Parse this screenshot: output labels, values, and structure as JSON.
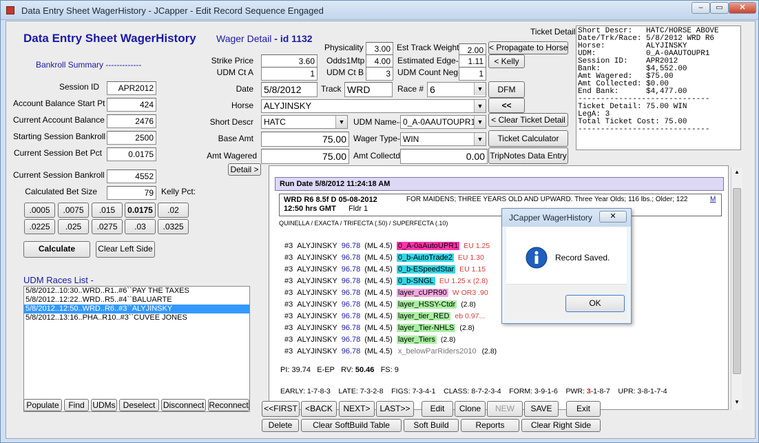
{
  "window": {
    "title": "Data Entry Sheet WagerHistory - JCapper -   Edit Record Sequence Engaged",
    "minimize": "‒",
    "maximize": "▭",
    "close": "✕"
  },
  "left": {
    "heading": "Data Entry Sheet WagerHistory",
    "bankroll_heading": "Bankroll Summary -------------",
    "fields": [
      {
        "label": "Session ID",
        "value": "APR2012"
      },
      {
        "label": "Account Balance Start Pt",
        "value": "424"
      },
      {
        "label": "Current Account Balance",
        "value": "2476"
      },
      {
        "label": "Starting Session Bankroll",
        "value": "2500"
      },
      {
        "label": "Current Session Bet Pct",
        "value": "0.0175"
      },
      {
        "label": "Current Session Bankroll",
        "value": "4552"
      },
      {
        "label": "Calculated Bet Size",
        "value": "79"
      }
    ],
    "kelly_pct_label": "Kelly Pct:",
    "pct_buttons_row1": [
      ".0005",
      ".0075",
      ".015",
      "0.0175",
      ".02"
    ],
    "pct_buttons_row2": [
      ".0225",
      ".025",
      ".0275",
      ".03",
      ".0325"
    ],
    "calculate": "Calculate",
    "clear_left": "Clear Left Side",
    "udm_races_heading": "UDM Races List -",
    "udm_races": [
      "5/8/2012..10:30..WRD..R1..#6``PAY THE TAXES",
      "5/8/2012..12:22..WRD..R5..#4``BALUARTE",
      "5/8/2012..12:50..WRD..R6..#3``ALYJINSKY",
      "5/8/2012..13:16..PHA..R10..#3``CUVEE JONES"
    ],
    "selected_race_index": 2,
    "bottom_buttons": [
      "Populate",
      "Find",
      "UDMs",
      "Deselect",
      "Disconnect",
      "Reconnect"
    ]
  },
  "wager": {
    "heading": "Wager Detail",
    "id": "- id 1132",
    "strike_price_label": "Strike Price",
    "strike_price": "3.60",
    "udm_ct_a_label": "UDM Ct A",
    "udm_ct_a": "1",
    "physicality_label": "Physicality",
    "physicality": "3.00",
    "odds1mtp_label": "Odds1Mtp",
    "odds1mtp": "4.00",
    "udm_ct_b_label": "UDM Ct B",
    "udm_ct_b": "3",
    "est_track_weight_label": "Est Track Weight--",
    "est_track_weight": "2.00",
    "estimated_edge_label": "Estimated Edge---",
    "estimated_edge": "1.11",
    "udm_count_neg_label": "UDM Count Neg---",
    "udm_count_neg": "1",
    "date_label": "Date",
    "date": "5/8/2012",
    "track_label": "Track",
    "track": "WRD",
    "race_label": "Race #",
    "race": "6",
    "horse_label": "Horse",
    "horse": "ALYJINSKY",
    "short_descr_label": "Short Descr",
    "short_descr": "HATC",
    "udm_name_label": "UDM Name--",
    "udm_name": "0_A-0AAUTOUPR1",
    "base_amt_label": "Base Amt",
    "base_amt": "75.00",
    "wager_type_label": "Wager Type-",
    "wager_type": "WIN",
    "amt_wagered_label": "Amt Wagered",
    "amt_wagered": "75.00",
    "amt_collected_label": "Amt Collectd-",
    "amt_collected": "0.00",
    "detail_button": "Detail >"
  },
  "right_buttons": {
    "propagate": "< Propagate to Horse",
    "kelly": "< Kelly",
    "dfm": "DFM",
    "back": "<<",
    "clear_ticket": "< Clear Ticket Detail",
    "ticket_calc": "Ticket Calculator",
    "tripnotes": "TripNotes Data Entry"
  },
  "ticket": {
    "label": "Ticket Detail--",
    "text": "Short Descr:   HATC/HORSE ABOVE\nDate/Trk/Race: 5/8/2012 WRD R6\nHorse:         ALYJINSKY\nUDM:           0_A-0AAUTOUPR1\nSession ID:    APR2012\nBank:          $4,552.00\nAmt Wagered:   $75.00\nAmt Collected: $0.00\nEnd Bank:      $4,477.00\n-----------------------------\nTicket Detail: 75.00 WIN\nLegA: 3\nTotal Ticket Cost: 75.00\n-----------------------------"
  },
  "sheet": {
    "rundate": "Run Date 5/8/2012 11:24:18 AM",
    "race_hdr1": "WRD R6 8.5f D 05-08-2012",
    "race_conditions": "FOR MAIDENS; THREE YEARS OLD AND UPWARD. Three Year Olds; 116 lbs.; Older; 122",
    "race_m": "M",
    "race_hdr2": "12:50  hrs GMT",
    "race_fldr": "Fldr 1",
    "bet_types": "QUINELLA / EXACTA / TRIFECTA (.50) / SUPERFECTA (.10)",
    "rows": [
      {
        "post": "#3",
        "horse": "ALYJINSKY",
        "score": "96.78",
        "ml": "(ML 4.5)",
        "udm": "0_A-0aAutoUPR1",
        "tail": "EU 1.25",
        "tail_color": "#d63a3a",
        "bg": "#ff33aa",
        "fg": "#000000"
      },
      {
        "post": "#3",
        "horse": "ALYJINSKY",
        "score": "96.78",
        "ml": "(ML 4.5)",
        "udm": "0_b-AutoTrade2",
        "tail": "EU 1.30",
        "tail_color": "#d63a3a",
        "bg": "#33d6e6",
        "fg": "#000000"
      },
      {
        "post": "#3",
        "horse": "ALYJINSKY",
        "score": "96.78",
        "ml": "(ML 4.5)",
        "udm": "0_b-ESpeedStar",
        "tail": "EU 1.15",
        "tail_color": "#d63a3a",
        "bg": "#33d6e6",
        "fg": "#000000"
      },
      {
        "post": "#3",
        "horse": "ALYJINSKY",
        "score": "96.78",
        "ml": "(ML 4.5)",
        "udm": "0_b-SNGL",
        "tail": "EU 1.25  x  (2.8)",
        "tail_color": "#d63a3a",
        "bg": "#33d6e6",
        "fg": "#000000"
      },
      {
        "post": "#3",
        "horse": "ALYJINSKY",
        "score": "96.78",
        "ml": "(ML 4.5)",
        "udm": "layer_cUPR90",
        "tail": "W OR3 .90",
        "tail_color": "#d63a3a",
        "bg": "#f3a8e0",
        "fg": "#000000"
      },
      {
        "post": "#3",
        "horse": "ALYJINSKY",
        "score": "96.78",
        "ml": "(ML 4.5)",
        "udm": "layer_HSSY-Ctdr",
        "tail": "(2.8)",
        "tail_color": "#000000",
        "bg": "#a9f0a1",
        "fg": "#000000"
      },
      {
        "post": "#3",
        "horse": "ALYJINSKY",
        "score": "96.78",
        "ml": "(ML 4.5)",
        "udm": "layer_tier_RED",
        "tail": "eb 0.97...",
        "tail_color": "#d63a3a",
        "bg": "#a9f0a1",
        "fg": "#000000"
      },
      {
        "post": "#3",
        "horse": "ALYJINSKY",
        "score": "96.78",
        "ml": "(ML 4.5)",
        "udm": "layer_Tier-NHLS",
        "tail": "(2.8)",
        "tail_color": "#000000",
        "bg": "#a9f0a1",
        "fg": "#000000"
      },
      {
        "post": "#3",
        "horse": "ALYJINSKY",
        "score": "96.78",
        "ml": "(ML 4.5)",
        "udm": "layer_Tiers",
        "tail": "(2.8)",
        "tail_color": "#000000",
        "bg": "#a9f0a1",
        "fg": "#000000"
      },
      {
        "post": "#3",
        "horse": "ALYJINSKY",
        "score": "96.78",
        "ml": "(ML 4.5)",
        "udm": "x_belowParRiders2010",
        "tail": "(2.8)",
        "tail_color": "#000000",
        "bg": "#ffffff",
        "fg": "#777777"
      }
    ],
    "pi_line": {
      "pi": "PI: 39.74",
      "eep": "E-EP",
      "rv": "RV:",
      "rv_val": "50.46",
      "fs": "FS: 9"
    },
    "summary_line": "EARLY: 1-7-8-3    LATE: 7-3-2-8    FIGS: 7-3-4-1    CLASS: 8-7-2-3-4    FORM: 3-9-1-6    PWR:",
    "pwr_red": "3",
    "pwr_rest": "-1-8-7    UPR: 3-8-1-7-4"
  },
  "bottom_bar": {
    "row1": [
      "<<FIRST",
      "<BACK",
      "NEXT>",
      "LAST>>",
      "Edit",
      "Clone",
      "NEW",
      "SAVE",
      "Exit"
    ],
    "row2": [
      "Delete",
      "Clear SoftBuild Table",
      "Soft Build",
      "Reports",
      "Clear Right Side"
    ]
  },
  "dialog": {
    "title": "JCapper WagerHistory",
    "close": "✕",
    "icon": "info-icon",
    "message": "Record Saved.",
    "ok": "OK"
  },
  "colors": {
    "heading_blue": "#1a1aa6",
    "selection": "#3399ff",
    "sheet_header": "#ddd8f6"
  }
}
